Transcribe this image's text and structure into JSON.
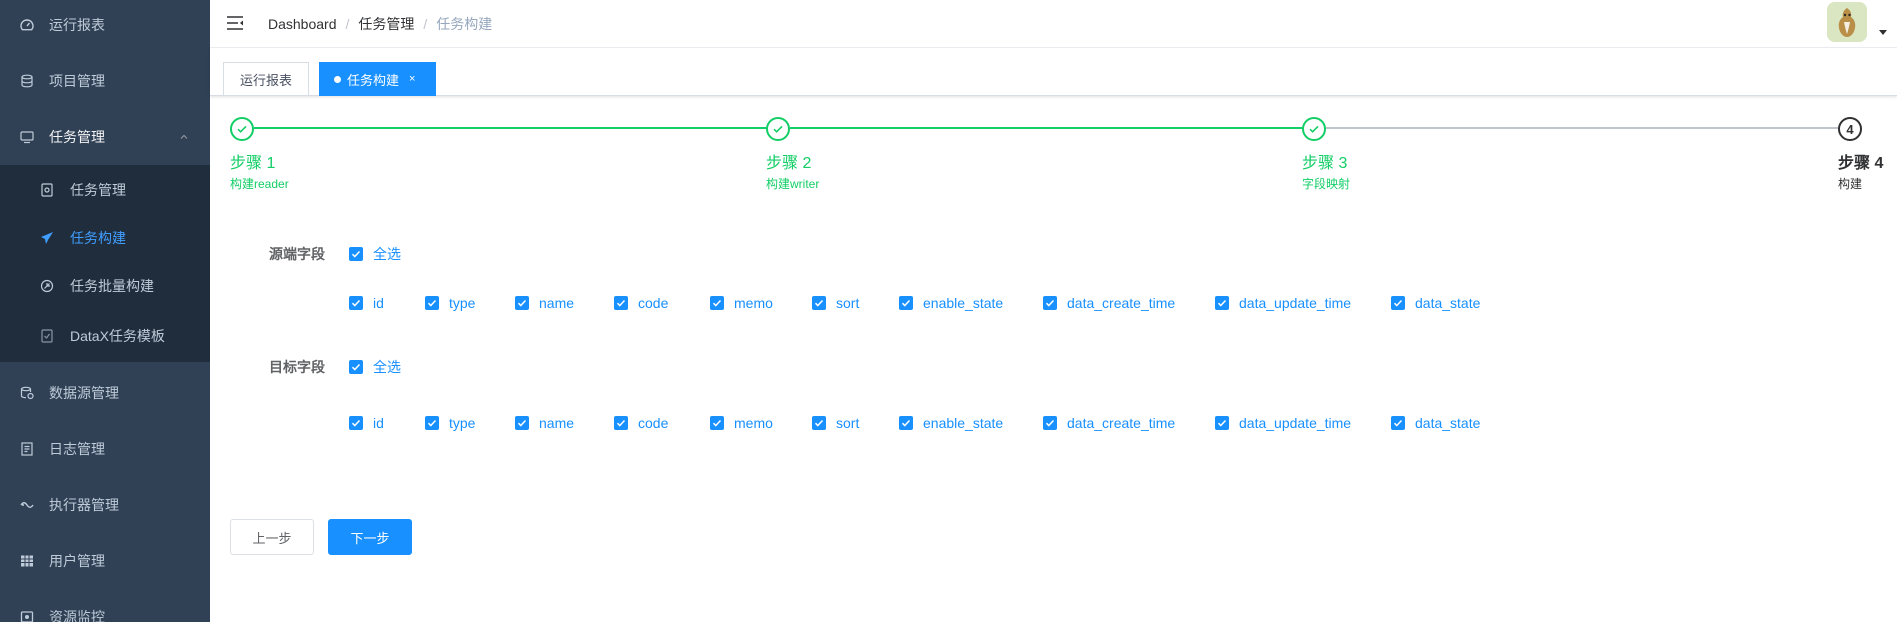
{
  "sidebar": {
    "items": [
      {
        "label": "运行报表",
        "icon": "dashboard-icon"
      },
      {
        "label": "项目管理",
        "icon": "database-icon"
      },
      {
        "label": "任务管理",
        "icon": "monitor-icon"
      },
      {
        "label": "数据源管理",
        "icon": "datasource-icon"
      },
      {
        "label": "日志管理",
        "icon": "log-icon"
      },
      {
        "label": "执行器管理",
        "icon": "executor-icon"
      },
      {
        "label": "用户管理",
        "icon": "table-icon"
      },
      {
        "label": "资源监控",
        "icon": "monitor-resource-icon"
      }
    ],
    "submenu": [
      {
        "label": "任务管理",
        "icon": "task-icon"
      },
      {
        "label": "任务构建",
        "icon": "send-icon"
      },
      {
        "label": "任务批量构建",
        "icon": "batch-icon"
      },
      {
        "label": "DataX任务模板",
        "icon": "template-icon"
      }
    ]
  },
  "navbar": {
    "breadcrumb": [
      "Dashboard",
      "任务管理",
      "任务构建"
    ]
  },
  "tags": [
    {
      "label": "运行报表"
    },
    {
      "label": "任务构建",
      "close": "×"
    }
  ],
  "steps": [
    {
      "title": "步骤 1",
      "desc": "构建reader",
      "status": "finish"
    },
    {
      "title": "步骤 2",
      "desc": "构建writer",
      "status": "finish"
    },
    {
      "title": "步骤 3",
      "desc": "字段映射",
      "status": "finish"
    },
    {
      "title": "步骤 4",
      "desc": "构建",
      "status": "process",
      "num": "4"
    }
  ],
  "form": {
    "source_label": "源端字段",
    "target_label": "目标字段",
    "select_all": "全选",
    "source_fields": [
      "id",
      "type",
      "name",
      "code",
      "memo",
      "sort",
      "enable_state",
      "data_create_time",
      "data_update_time",
      "data_state"
    ],
    "target_fields": [
      "id",
      "type",
      "name",
      "code",
      "memo",
      "sort",
      "enable_state",
      "data_create_time",
      "data_update_time",
      "data_state"
    ]
  },
  "buttons": {
    "prev": "上一步",
    "next": "下一步"
  },
  "colors": {
    "sidebar_bg": "#304156",
    "submenu_bg": "#1f2d3d",
    "primary": "#1890ff",
    "success": "#13ce66"
  }
}
